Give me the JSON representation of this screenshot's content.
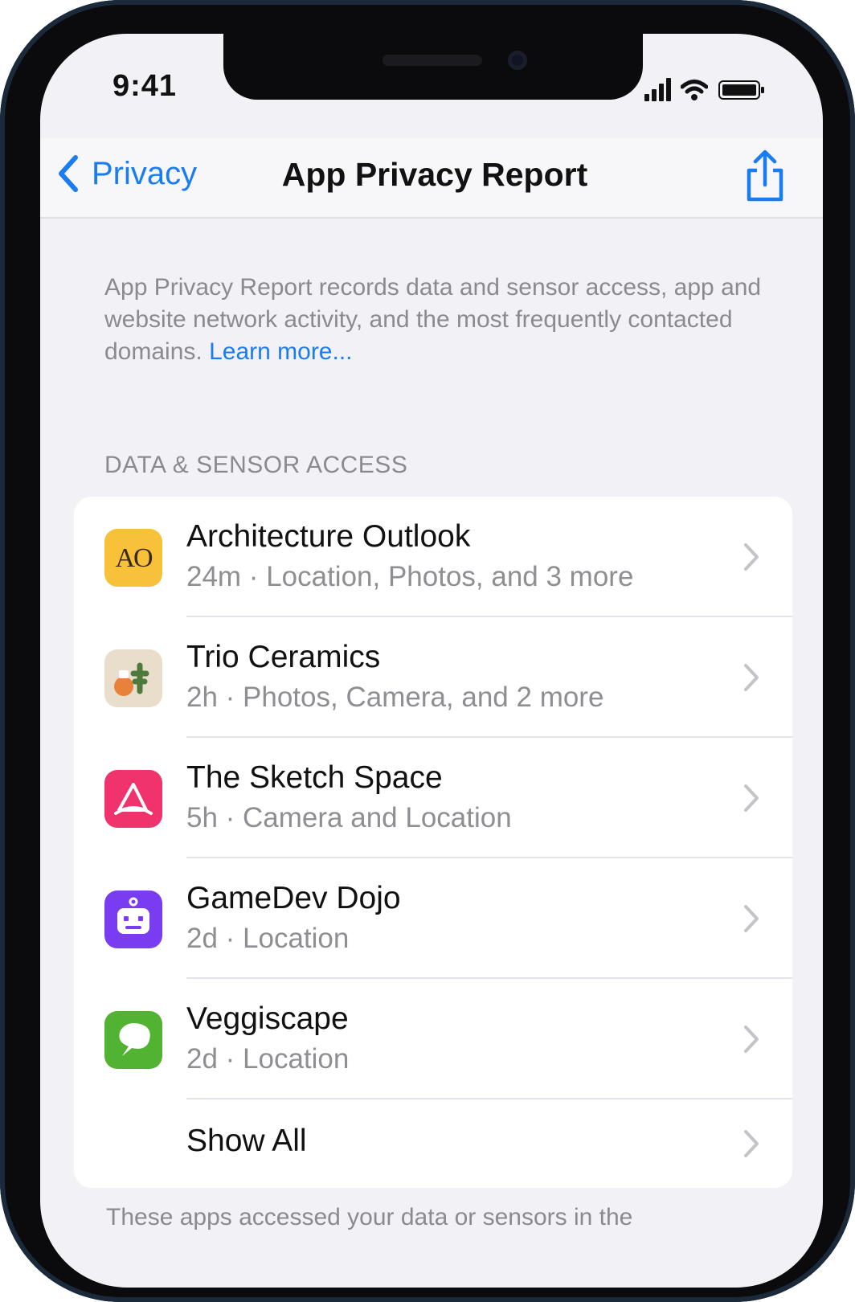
{
  "status_bar": {
    "time": "9:41"
  },
  "nav": {
    "back_label": "Privacy",
    "title": "App Privacy Report",
    "share_icon": "share-icon"
  },
  "intro": {
    "text": "App Privacy Report records data and sensor access, app and website network activity, and the most frequently contacted domains.",
    "link": "Learn more..."
  },
  "section": {
    "header": "DATA & SENSOR ACCESS"
  },
  "apps": [
    {
      "name": "Architecture Outlook",
      "detail": "24m · Location, Photos, and 3 more",
      "icon": "architecture-outlook-icon",
      "icon_text": "AO",
      "color": "#f7c23a"
    },
    {
      "name": "Trio Ceramics",
      "detail": "2h · Photos, Camera, and 2 more",
      "icon": "trio-ceramics-icon",
      "color": "#e9ddcc"
    },
    {
      "name": "The Sketch Space",
      "detail": "5h · Camera and Location",
      "icon": "sketch-space-icon",
      "color": "#f0336c"
    },
    {
      "name": "GameDev Dojo",
      "detail": "2d · Location",
      "icon": "gamedev-dojo-icon",
      "color": "#7a3cf0"
    },
    {
      "name": "Veggiscape",
      "detail": "2d · Location",
      "icon": "veggiscape-icon",
      "color": "#52b332"
    }
  ],
  "show_all": "Show All",
  "footer": "These apps accessed your data or sensors in the"
}
